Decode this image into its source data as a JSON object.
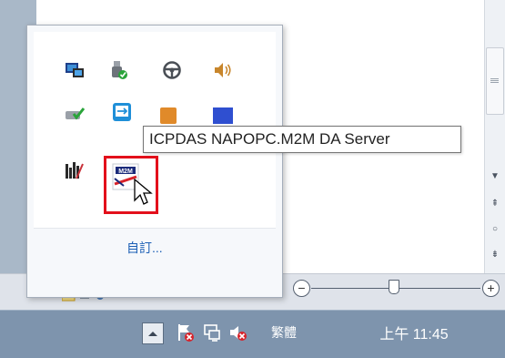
{
  "tray_popup": {
    "customize_label": "自訂...",
    "icons": [
      "network-monitor-icon",
      "usb-safe-remove-icon",
      "steering-wheel-icon",
      "speaker-icon",
      "checkmark-drive-icon",
      "remote-access-icon",
      "orange-app-icon",
      "blue-app-icon",
      "bar-chart-app-icon",
      "m2m-da-server-icon"
    ]
  },
  "tooltip": {
    "text": "ICPDAS NAPOPC.M2M DA Server"
  },
  "taskbar": {
    "language_label": "繁體",
    "clock": "上午 11:45",
    "tray_icons": [
      "show-hidden-icons-button",
      "action-center-flag-icon",
      "network-icon",
      "volume-muted-icon"
    ]
  },
  "statusbar": {
    "zoom_minus": "−",
    "zoom_plus": "+"
  },
  "scrollbar": {
    "glyphs": [
      "▼",
      "⇞",
      "○",
      "⇟"
    ]
  },
  "colors": {
    "taskbar": "#7e94ad",
    "highlight": "#e3101b",
    "link": "#1c5fb5"
  }
}
